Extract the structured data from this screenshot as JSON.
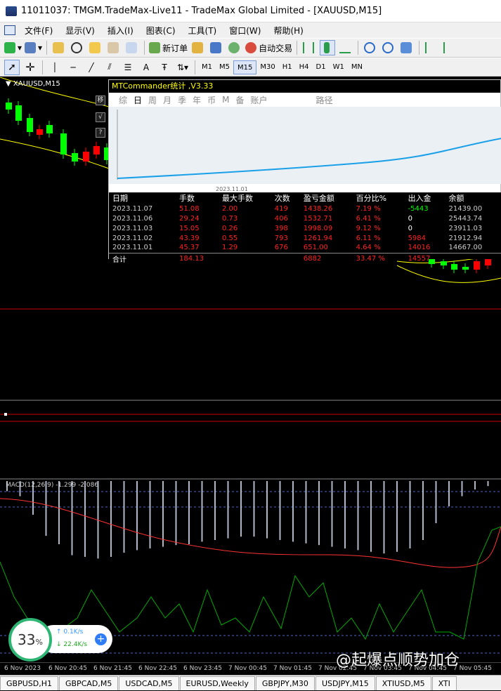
{
  "window": {
    "title": "11011037: TMGM.TradeMax-Live11 - TradeMax Global Limited - [XAUUSD,M15]"
  },
  "menu": [
    "文件(F)",
    "显示(V)",
    "插入(I)",
    "图表(C)",
    "工具(T)",
    "窗口(W)",
    "帮助(H)"
  ],
  "toolbar": {
    "new_order": "新订单",
    "auto_trading": "自动交易"
  },
  "timeframes": [
    "M1",
    "M5",
    "M15",
    "M30",
    "H1",
    "H4",
    "D1",
    "W1",
    "MN"
  ],
  "active_timeframe": "M15",
  "chart": {
    "symbol_label": "XAUUSD,M15",
    "side_buttons": [
      "移",
      "√",
      "?"
    ],
    "macd_label": "MACD(12,26,9) -1.299 -2.086",
    "x_labels": [
      "6 Nov 2023",
      "6 Nov 20:45",
      "6 Nov 21:45",
      "6 Nov 22:45",
      "6 Nov 23:45",
      "7 Nov 00:45",
      "7 Nov 01:45",
      "7 Nov 02:45",
      "7 Nov 03:45",
      "7 Nov 04:45",
      "7 Nov 05:45",
      "7 Nov 06:45",
      "7 Nov 07:45"
    ],
    "colors": {
      "bull": "#00ff00",
      "bear": "#ff0000",
      "band": "#ffff00",
      "hline": "#cc0000",
      "macd_signal": "#ff3333",
      "osc": "#00aa00"
    }
  },
  "panel": {
    "title": "MTCommander统计 ,V3.33",
    "tabs": [
      "综",
      "日",
      "周",
      "月",
      "季",
      "年",
      "币",
      "M",
      "备",
      "账户",
      "路径"
    ],
    "selected_tab": "日",
    "chart_date_label": "2023.11.01",
    "columns": [
      "日期",
      "手数",
      "最大手数",
      "次数",
      "盈亏金额",
      "百分比%",
      "出入金",
      "余额"
    ],
    "rows": [
      {
        "date": "2023.11.07",
        "lots": "51.08",
        "max_lots": "2.00",
        "count": "419",
        "pnl": "1438.26",
        "pct": "7.19 %",
        "flow": "-5443",
        "balance": "21439.00"
      },
      {
        "date": "2023.11.06",
        "lots": "29.24",
        "max_lots": "0.73",
        "count": "406",
        "pnl": "1532.71",
        "pct": "6.41 %",
        "flow": "0",
        "balance": "25443.74"
      },
      {
        "date": "2023.11.03",
        "lots": "15.05",
        "max_lots": "0.26",
        "count": "398",
        "pnl": "1998.09",
        "pct": "9.12 %",
        "flow": "0",
        "balance": "23911.03"
      },
      {
        "date": "2023.11.02",
        "lots": "43.39",
        "max_lots": "0.55",
        "count": "793",
        "pnl": "1261.94",
        "pct": "6.11 %",
        "flow": "5984",
        "balance": "21912.94"
      },
      {
        "date": "2023.11.01",
        "lots": "45.37",
        "max_lots": "1.29",
        "count": "676",
        "pnl": "651.00",
        "pct": "4.64 %",
        "flow": "14016",
        "balance": "14667.00"
      }
    ],
    "total": {
      "label": "合计",
      "lots": "184.13",
      "pnl": "6882",
      "pct": "33.47 %",
      "flow": "14557"
    }
  },
  "net_widget": {
    "percent": "33",
    "percent_sign": "%",
    "up": "0.1K/s",
    "down": "22.4K/s"
  },
  "watermark": "@起爆点顺势加仓",
  "tabs": [
    "GBPUSD,H1",
    "GBPCAD,M5",
    "USDCAD,M5",
    "EURUSD,Weekly",
    "GBPJPY,M30",
    "USDJPY,M15",
    "XTIUSD,M5",
    "XTI"
  ]
}
